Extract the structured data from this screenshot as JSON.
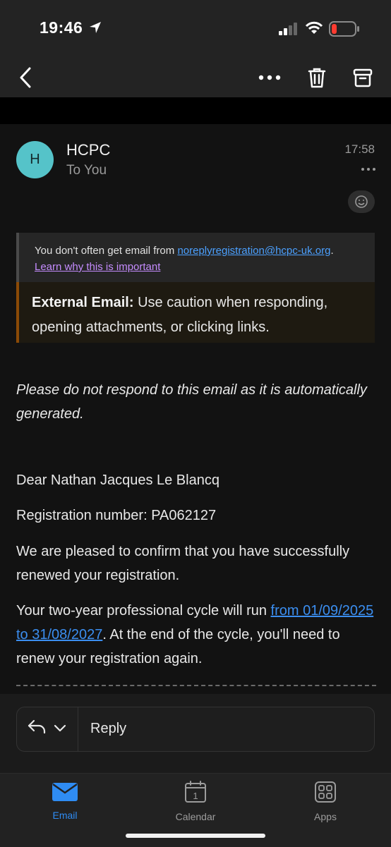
{
  "status_bar": {
    "time": "19:46"
  },
  "email": {
    "avatar_initial": "H",
    "sender": "HCPC",
    "recipient": "To You",
    "time": "17:58",
    "notice": {
      "text_before": "You don't often get email from ",
      "sender_link": "noreplyregistration@hcpc-uk.org",
      "text_after": ". ",
      "learn_link": "Learn why this is important"
    },
    "external": {
      "label": "External Email:",
      "text": " Use caution when responding, opening attachments, or clicking links."
    },
    "auto_note": "Please do not respond to this email as it is automatically generated.",
    "greeting": "Dear Nathan Jacques Le Blancq",
    "registration": "Registration number: PA062127",
    "confirmation": "We are pleased to confirm that you have successfully renewed your registration.",
    "cycle_before": "Your two-year professional cycle will run ",
    "cycle_link": "from 01/09/2025 to 31/08/2027",
    "cycle_after": ". At the end of the cycle, you'll need to renew your registration again."
  },
  "reply": {
    "label": "Reply"
  },
  "tabs": [
    {
      "label": "Email"
    },
    {
      "label": "Calendar",
      "day": "1"
    },
    {
      "label": "Apps"
    }
  ],
  "colors": {
    "accent": "#2f8cf3",
    "avatar": "#55c3c9",
    "external_border": "#8b4a06"
  }
}
